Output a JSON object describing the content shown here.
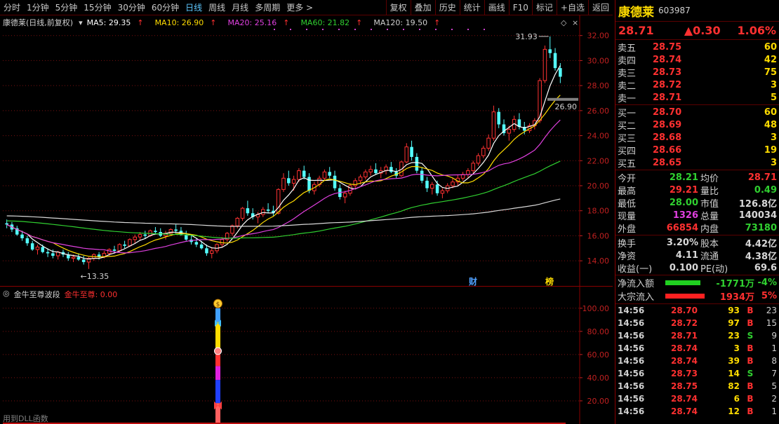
{
  "toolbar": {
    "periods": [
      "分时",
      "1分钟",
      "5分钟",
      "15分钟",
      "30分钟",
      "60分钟",
      "日线",
      "周线",
      "月线",
      "多周期",
      "更多 >"
    ],
    "active_period": "日线",
    "actions": [
      "复权",
      "叠加",
      "历史",
      "统计",
      "画线",
      "F10",
      "标记",
      "+自选",
      "返回"
    ]
  },
  "kline": {
    "title": "康德莱(日线,前复权)",
    "ma": [
      {
        "label": "MA5: 29.35",
        "color": "#ffffff"
      },
      {
        "label": "MA10: 26.90",
        "color": "#ffdc00"
      },
      {
        "label": "MA20: 25.16",
        "color": "#e040e0"
      },
      {
        "label": "MA60: 21.82",
        "color": "#30d030"
      },
      {
        "label": "MA120: 19.50",
        "color": "#d0d0d0"
      }
    ],
    "arrow": "↑",
    "y_ticks": [
      "32.00",
      "30.00",
      "28.00",
      "26.00",
      "24.00",
      "22.00",
      "20.00",
      "18.00",
      "16.00",
      "14.00"
    ],
    "high_label": "31.93",
    "low_label": "←13.35",
    "dash_label": "26.90",
    "markers": [
      "财",
      "榜"
    ]
  },
  "chart_data": {
    "type": "candlestick",
    "y_range": [
      13.0,
      32.6
    ],
    "candles": [
      [
        17.0,
        17.3,
        16.6,
        16.9
      ],
      [
        16.9,
        17.1,
        16.3,
        16.5
      ],
      [
        16.6,
        16.8,
        16.0,
        16.1
      ],
      [
        16.1,
        16.4,
        15.6,
        15.8
      ],
      [
        15.8,
        16.0,
        15.2,
        15.4
      ],
      [
        15.4,
        15.6,
        14.8,
        14.9
      ],
      [
        14.9,
        15.3,
        14.5,
        15.1
      ],
      [
        15.1,
        15.3,
        14.6,
        14.7
      ],
      [
        14.7,
        15.0,
        14.3,
        14.6
      ],
      [
        14.6,
        14.9,
        14.2,
        14.4
      ],
      [
        14.4,
        14.8,
        14.1,
        14.7
      ],
      [
        14.7,
        14.9,
        14.3,
        14.5
      ],
      [
        14.5,
        14.7,
        14.0,
        14.2
      ],
      [
        14.2,
        14.5,
        13.9,
        14.3
      ],
      [
        14.3,
        14.6,
        14.0,
        14.1
      ],
      [
        14.1,
        14.4,
        13.7,
        13.9
      ],
      [
        13.9,
        14.3,
        13.35,
        14.2
      ],
      [
        14.2,
        14.6,
        14.0,
        14.5
      ],
      [
        14.5,
        14.7,
        14.1,
        14.3
      ],
      [
        14.3,
        14.8,
        14.2,
        14.6
      ],
      [
        14.6,
        15.0,
        14.4,
        14.9
      ],
      [
        14.9,
        15.2,
        14.6,
        14.8
      ],
      [
        14.8,
        15.4,
        14.7,
        15.3
      ],
      [
        15.3,
        15.6,
        15.0,
        15.2
      ],
      [
        15.2,
        15.8,
        15.1,
        15.7
      ],
      [
        15.7,
        16.1,
        15.4,
        15.9
      ],
      [
        15.9,
        16.3,
        15.6,
        16.1
      ],
      [
        16.1,
        16.4,
        15.8,
        16.0
      ],
      [
        16.0,
        16.5,
        15.9,
        16.4
      ],
      [
        16.4,
        16.7,
        16.1,
        16.3
      ],
      [
        16.3,
        16.6,
        15.9,
        16.0
      ],
      [
        16.0,
        16.4,
        15.7,
        16.2
      ],
      [
        16.2,
        16.6,
        16.0,
        16.5
      ],
      [
        16.5,
        16.9,
        16.2,
        16.4
      ],
      [
        16.4,
        16.7,
        16.0,
        16.1
      ],
      [
        16.1,
        16.4,
        15.6,
        15.7
      ],
      [
        15.7,
        16.0,
        15.3,
        15.5
      ],
      [
        15.5,
        15.8,
        15.1,
        15.3
      ],
      [
        15.3,
        15.6,
        14.9,
        15.0
      ],
      [
        15.0,
        15.3,
        14.4,
        14.6
      ],
      [
        14.6,
        15.0,
        14.2,
        14.8
      ],
      [
        14.8,
        15.4,
        14.6,
        15.3
      ],
      [
        15.3,
        15.9,
        15.1,
        15.7
      ],
      [
        15.7,
        16.3,
        15.5,
        16.2
      ],
      [
        16.2,
        16.9,
        16.0,
        16.8
      ],
      [
        16.8,
        17.5,
        16.6,
        17.4
      ],
      [
        17.4,
        18.3,
        17.2,
        18.2
      ],
      [
        18.2,
        18.8,
        17.6,
        17.8
      ],
      [
        17.8,
        18.2,
        17.3,
        17.5
      ],
      [
        17.5,
        17.9,
        17.0,
        17.7
      ],
      [
        17.7,
        18.3,
        17.5,
        18.1
      ],
      [
        18.1,
        18.6,
        17.8,
        18.0
      ],
      [
        18.0,
        18.4,
        17.6,
        17.8
      ],
      [
        17.8,
        19.8,
        17.7,
        19.7
      ],
      [
        19.7,
        21.0,
        19.5,
        20.6
      ],
      [
        20.6,
        21.2,
        20.0,
        20.2
      ],
      [
        20.2,
        20.8,
        19.6,
        20.5
      ],
      [
        20.5,
        21.4,
        20.3,
        21.2
      ],
      [
        21.2,
        21.6,
        20.5,
        20.7
      ],
      [
        20.7,
        21.0,
        19.4,
        19.6
      ],
      [
        19.6,
        20.3,
        19.3,
        20.1
      ],
      [
        20.1,
        20.8,
        19.9,
        20.6
      ],
      [
        20.6,
        21.3,
        20.4,
        21.1
      ],
      [
        21.1,
        21.5,
        20.6,
        20.8
      ],
      [
        20.8,
        21.2,
        19.6,
        19.8
      ],
      [
        19.8,
        20.1,
        18.9,
        19.1
      ],
      [
        19.1,
        19.6,
        18.6,
        19.4
      ],
      [
        19.4,
        20.2,
        19.2,
        20.0
      ],
      [
        20.0,
        20.6,
        19.7,
        20.4
      ],
      [
        20.4,
        20.9,
        20.1,
        20.7
      ],
      [
        20.7,
        21.3,
        20.5,
        21.1
      ],
      [
        21.1,
        21.6,
        20.8,
        21.3
      ],
      [
        21.3,
        21.8,
        20.9,
        21.0
      ],
      [
        21.0,
        21.5,
        20.6,
        21.2
      ],
      [
        21.2,
        21.7,
        20.9,
        21.5
      ],
      [
        21.5,
        21.9,
        21.0,
        21.1
      ],
      [
        21.1,
        21.4,
        20.6,
        20.8
      ],
      [
        20.8,
        22.0,
        20.7,
        21.9
      ],
      [
        21.9,
        23.4,
        21.8,
        23.1
      ],
      [
        23.1,
        23.6,
        22.0,
        22.3
      ],
      [
        22.3,
        22.6,
        21.0,
        21.2
      ],
      [
        21.2,
        21.5,
        20.2,
        20.4
      ],
      [
        20.4,
        20.7,
        19.5,
        19.8
      ],
      [
        19.8,
        20.3,
        19.3,
        20.1
      ],
      [
        20.1,
        20.4,
        19.2,
        19.4
      ],
      [
        19.4,
        19.8,
        19.0,
        19.6
      ],
      [
        19.6,
        20.2,
        19.4,
        20.0
      ],
      [
        20.0,
        20.6,
        19.8,
        20.3
      ],
      [
        20.3,
        20.9,
        20.0,
        20.6
      ],
      [
        20.6,
        21.1,
        20.4,
        20.9
      ],
      [
        20.9,
        21.4,
        20.6,
        21.2
      ],
      [
        21.2,
        22.0,
        21.0,
        21.8
      ],
      [
        21.8,
        22.6,
        21.6,
        22.4
      ],
      [
        22.4,
        23.2,
        22.2,
        23.0
      ],
      [
        23.0,
        24.1,
        22.8,
        23.8
      ],
      [
        23.8,
        26.4,
        23.6,
        25.9
      ],
      [
        25.9,
        26.2,
        24.6,
        24.9
      ],
      [
        24.9,
        25.3,
        24.0,
        24.2
      ],
      [
        24.2,
        24.8,
        23.6,
        24.5
      ],
      [
        24.5,
        25.6,
        24.3,
        25.3
      ],
      [
        25.3,
        25.8,
        24.5,
        24.7
      ],
      [
        24.7,
        25.1,
        24.1,
        24.4
      ],
      [
        24.4,
        25.0,
        24.2,
        24.8
      ],
      [
        24.8,
        25.4,
        24.5,
        25.2
      ],
      [
        25.2,
        28.6,
        25.0,
        28.4
      ],
      [
        28.4,
        31.2,
        28.2,
        30.9
      ],
      [
        30.9,
        31.93,
        30.2,
        30.6
      ],
      [
        30.6,
        31.0,
        29.2,
        29.4
      ],
      [
        29.4,
        29.8,
        28.2,
        28.71
      ]
    ],
    "indicator": {
      "title": "金牛至尊波段",
      "value_label": "金牛至尊: 0.00",
      "y_ticks": [
        "100.00",
        "80.00",
        "60.00",
        "40.00",
        "20.00"
      ],
      "y_range": [
        0,
        115
      ],
      "footer": "用到DLL函数"
    }
  },
  "quote": {
    "name": "康德莱",
    "code": "603987",
    "price": "28.71",
    "change": "▲0.30",
    "change_pct": "1.06%",
    "asks": [
      {
        "label": "卖五",
        "price": "28.75",
        "vol": "60"
      },
      {
        "label": "卖四",
        "price": "28.74",
        "vol": "42"
      },
      {
        "label": "卖三",
        "price": "28.73",
        "vol": "75"
      },
      {
        "label": "卖二",
        "price": "28.72",
        "vol": "3"
      },
      {
        "label": "卖一",
        "price": "28.71",
        "vol": "5"
      }
    ],
    "bids": [
      {
        "label": "买一",
        "price": "28.70",
        "vol": "60"
      },
      {
        "label": "买二",
        "price": "28.69",
        "vol": "48"
      },
      {
        "label": "买三",
        "price": "28.68",
        "vol": "3"
      },
      {
        "label": "买四",
        "price": "28.66",
        "vol": "19"
      },
      {
        "label": "买五",
        "price": "28.65",
        "vol": "3"
      }
    ],
    "stats1": [
      {
        "l1": "今开",
        "v1": "28.21",
        "c1": "green",
        "l2": "均价",
        "v2": "28.71",
        "c2": "red"
      },
      {
        "l1": "最高",
        "v1": "29.21",
        "c1": "red",
        "l2": "量比",
        "v2": "0.49",
        "c2": "green"
      },
      {
        "l1": "最低",
        "v1": "28.00",
        "c1": "green",
        "l2": "市值",
        "v2": "126.8亿",
        "c2": "white"
      },
      {
        "l1": "现量",
        "v1": "1326",
        "c1": "magenta",
        "l2": "总量",
        "v2": "140034",
        "c2": "white"
      },
      {
        "l1": "外盘",
        "v1": "66854",
        "c1": "red",
        "l2": "内盘",
        "v2": "73180",
        "c2": "green"
      }
    ],
    "stats2": [
      {
        "l1": "换手",
        "v1": "3.20%",
        "c1": "white",
        "l2": "股本",
        "v2": "4.42亿",
        "c2": "white"
      },
      {
        "l1": "净资",
        "v1": "4.11",
        "c1": "white",
        "l2": "流通",
        "v2": "4.38亿",
        "c2": "white"
      },
      {
        "l1": "收益(一)",
        "v1": "0.100",
        "c1": "white",
        "l2": "PE(动)",
        "v2": "69.6",
        "c2": "white"
      }
    ],
    "flows": [
      {
        "label": "净流入额",
        "value": "-1771万",
        "pct": "-4%",
        "color": "green",
        "bar_color": "#20d020",
        "bar_width": 50
      },
      {
        "label": "大宗流入",
        "value": "1934万",
        "pct": "5%",
        "color": "red",
        "bar_color": "#ff2020",
        "bar_width": 56
      }
    ],
    "ticks": [
      {
        "time": "14:56",
        "price": "28.70",
        "vol": "93",
        "bs": "B",
        "bs_color": "red",
        "n": "23"
      },
      {
        "time": "14:56",
        "price": "28.72",
        "vol": "97",
        "bs": "B",
        "bs_color": "red",
        "n": "15"
      },
      {
        "time": "14:56",
        "price": "28.71",
        "vol": "23",
        "bs": "S",
        "bs_color": "green",
        "n": "9"
      },
      {
        "time": "14:56",
        "price": "28.74",
        "vol": "3",
        "bs": "B",
        "bs_color": "red",
        "n": "1"
      },
      {
        "time": "14:56",
        "price": "28.74",
        "vol": "39",
        "bs": "B",
        "bs_color": "red",
        "n": "8"
      },
      {
        "time": "14:56",
        "price": "28.73",
        "vol": "14",
        "bs": "S",
        "bs_color": "green",
        "n": "7"
      },
      {
        "time": "14:56",
        "price": "28.75",
        "vol": "82",
        "bs": "B",
        "bs_color": "red",
        "n": "5"
      },
      {
        "time": "14:56",
        "price": "28.74",
        "vol": "6",
        "bs": "B",
        "bs_color": "red",
        "n": "2"
      },
      {
        "time": "14:56",
        "price": "28.74",
        "vol": "12",
        "bs": "B",
        "bs_color": "red",
        "n": "1"
      }
    ]
  }
}
